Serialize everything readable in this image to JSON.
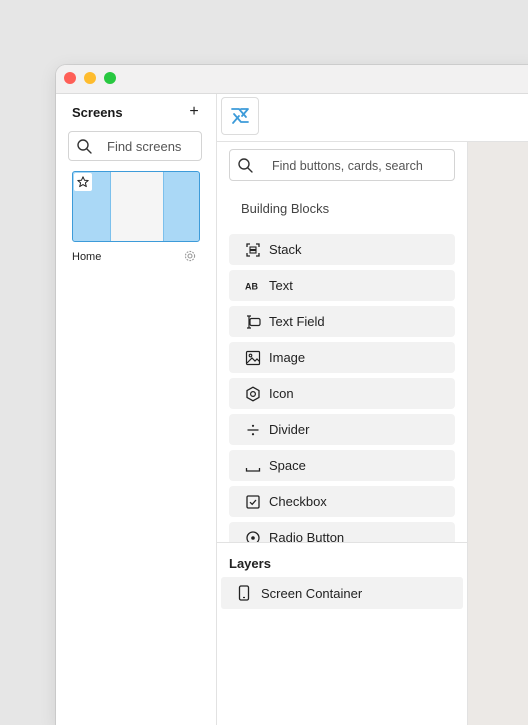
{
  "sidebar": {
    "title": "Screens",
    "add_label": "+",
    "search_placeholder": "Find screens",
    "screens": [
      {
        "name": "Home",
        "icon": "gear-icon"
      }
    ]
  },
  "panel": {
    "search_placeholder": "Find buttons, cards, search",
    "heading": "Building Blocks",
    "blocks": [
      {
        "label": "Stack",
        "icon": "stack-icon"
      },
      {
        "label": "Text",
        "icon": "text-ab-icon"
      },
      {
        "label": "Text Field",
        "icon": "text-field-icon"
      },
      {
        "label": "Image",
        "icon": "image-icon"
      },
      {
        "label": "Icon",
        "icon": "hexagon-icon"
      },
      {
        "label": "Divider",
        "icon": "divide-icon"
      },
      {
        "label": "Space",
        "icon": "space-icon"
      },
      {
        "label": "Checkbox",
        "icon": "checkbox-icon"
      },
      {
        "label": "Radio Button",
        "icon": "radio-icon"
      }
    ]
  },
  "layers": {
    "title": "Layers",
    "items": [
      {
        "label": "Screen Container",
        "icon": "phone-icon"
      }
    ]
  },
  "colors": {
    "accent": "#3d9bd9",
    "thumbnail_fill": "#aad8f6",
    "block_bg": "#f2f2f2",
    "canvas_bg": "#ece9e6"
  }
}
